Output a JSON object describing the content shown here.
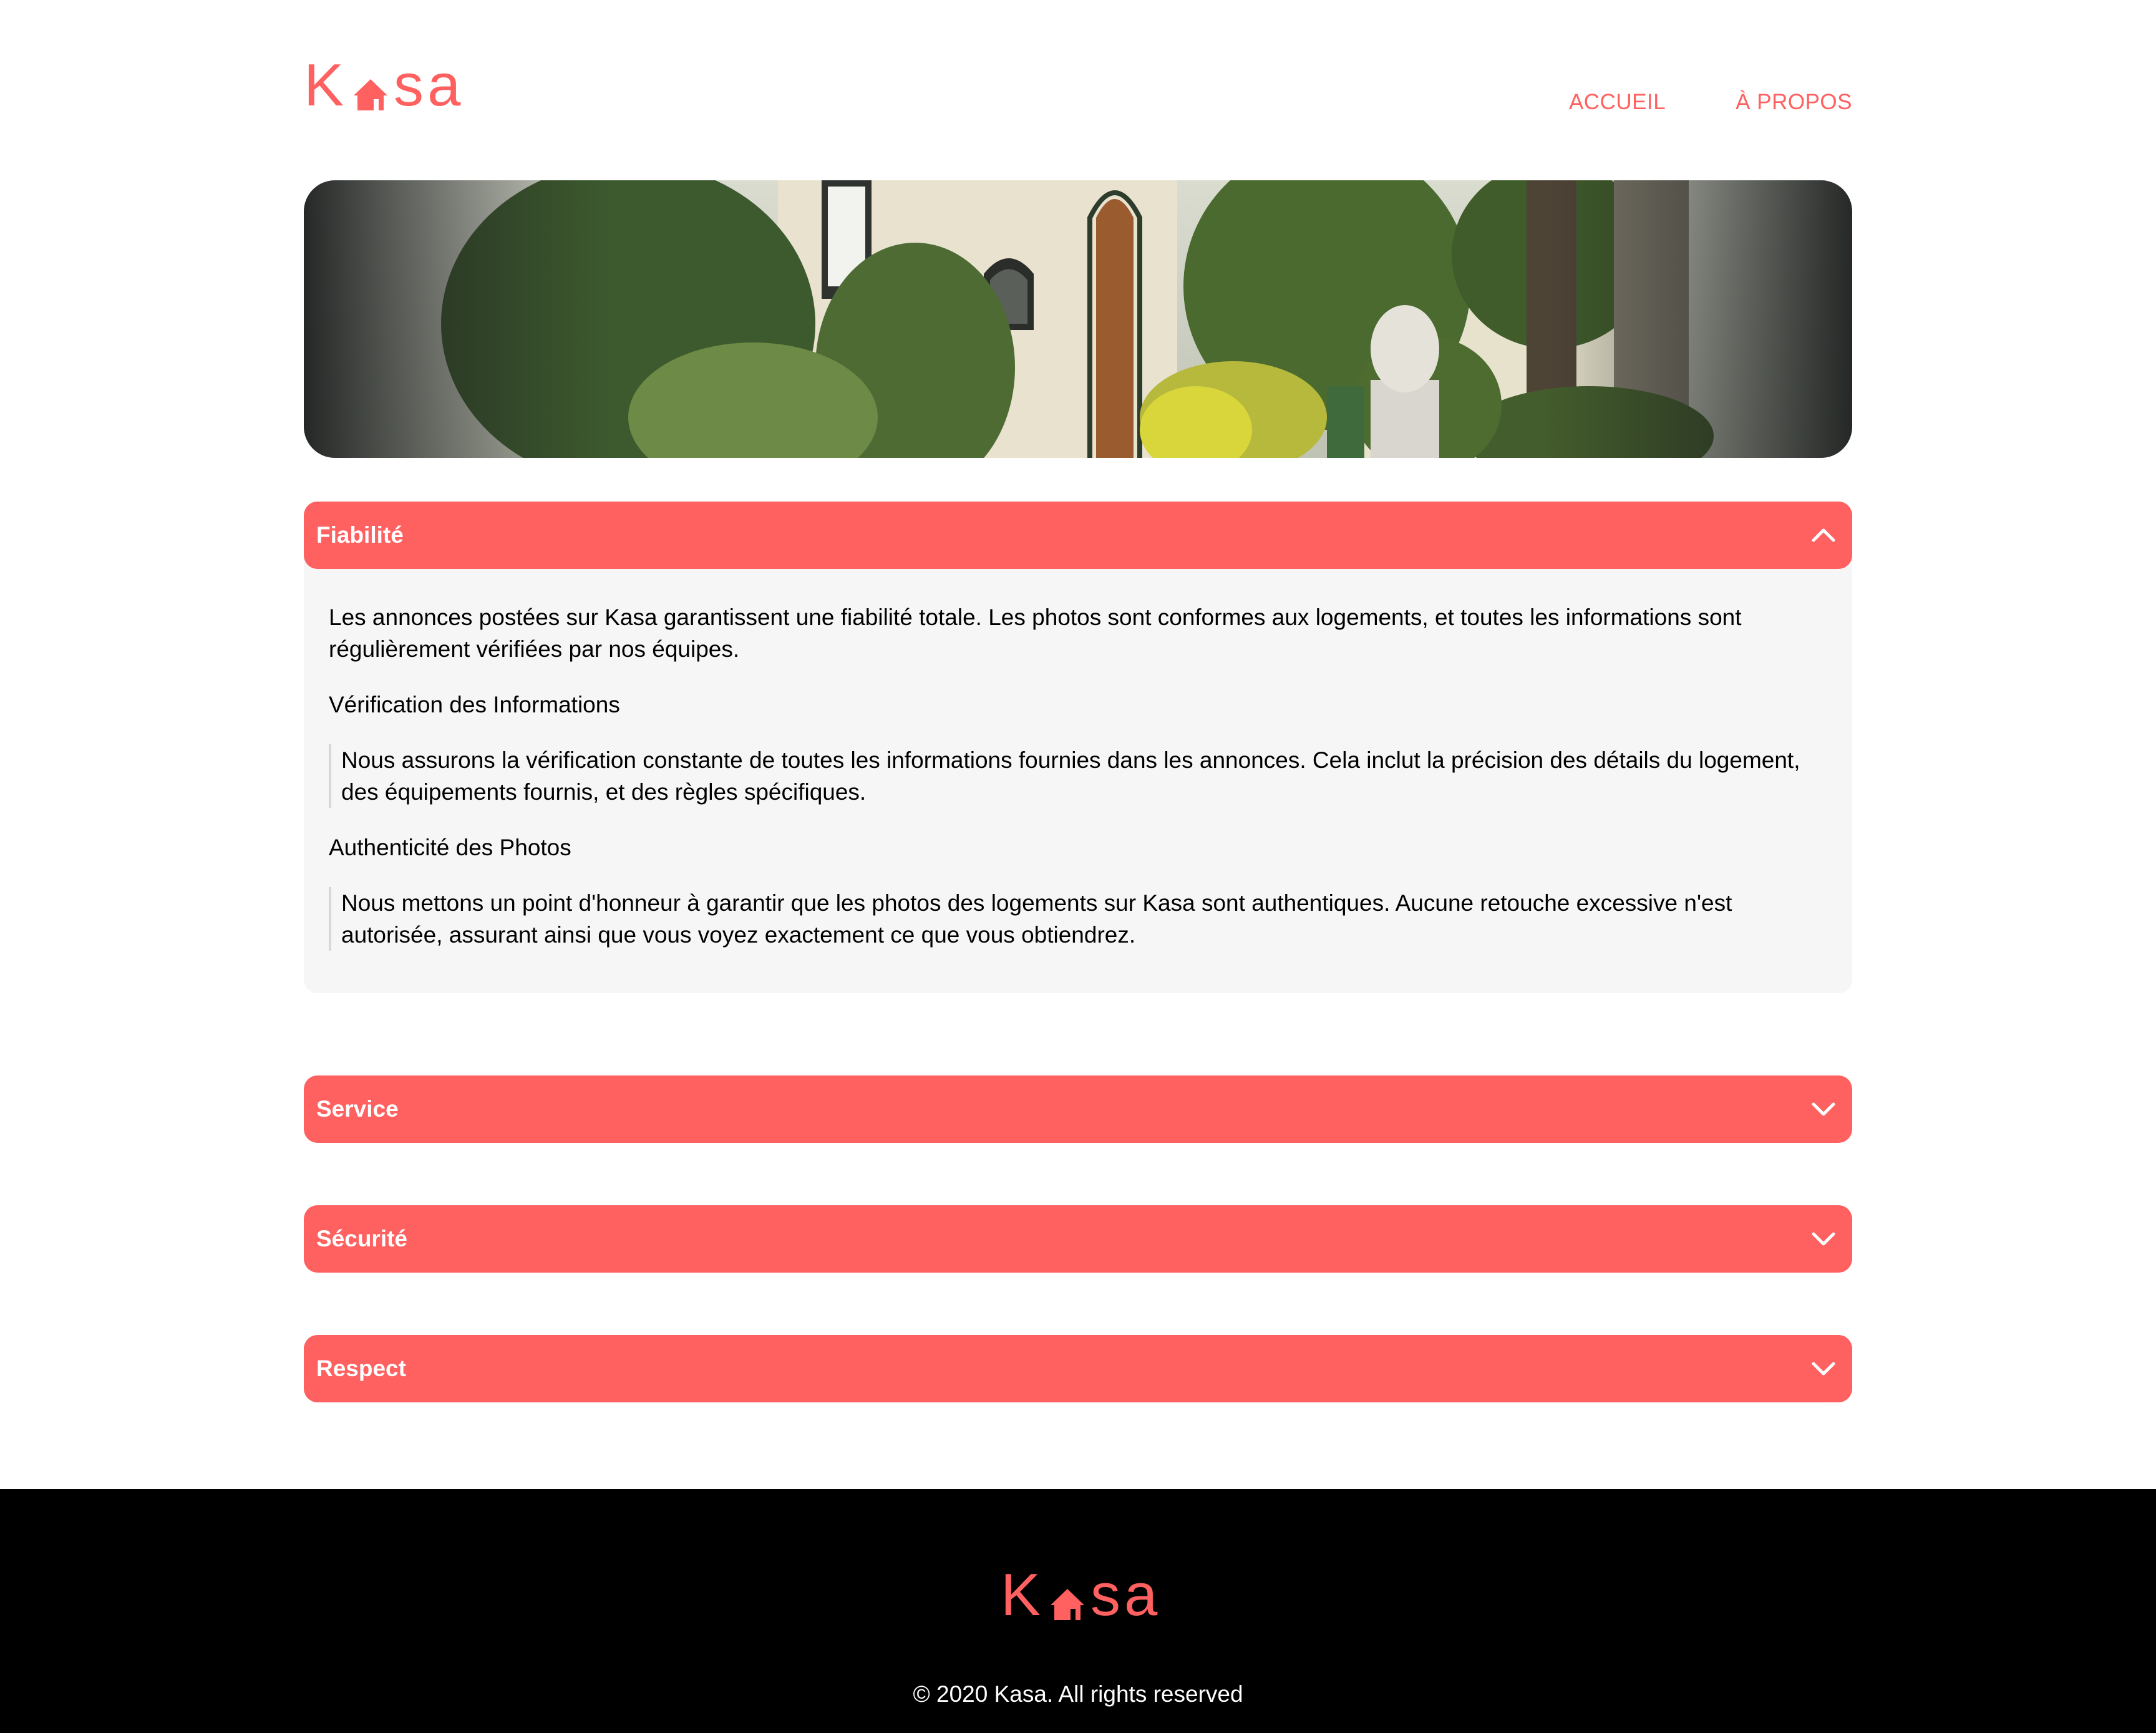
{
  "brand": {
    "logo_left": "K",
    "logo_right": "sa",
    "color": "#FF6060"
  },
  "nav": [
    {
      "label": "ACCUEIL"
    },
    {
      "label": "À PROPOS"
    }
  ],
  "banner": {
    "icon": "house-garden-photo"
  },
  "accordions": [
    {
      "title": "Fiabilité",
      "expanded": true,
      "icon": "chevron-up-icon",
      "lead": "Les annonces postées sur Kasa garantissent une fiabilité totale. Les photos sont conformes aux logements, et toutes les informations sont régulièrement vérifiées par nos équipes.",
      "sections": [
        {
          "heading": "Vérification des Informations",
          "text": "Nous assurons la vérification constante de toutes les informations fournies dans les annonces. Cela inclut la précision des détails du logement, des équipements fournis, et des règles spécifiques."
        },
        {
          "heading": "Authenticité des Photos",
          "text": "Nous mettons un point d'honneur à garantir que les photos des logements sur Kasa sont authentiques. Aucune retouche excessive n'est autorisée, assurant ainsi que vous voyez exactement ce que vous obtiendrez."
        }
      ]
    },
    {
      "title": "Service",
      "expanded": false,
      "icon": "chevron-down-icon"
    },
    {
      "title": "Sécurité",
      "expanded": false,
      "icon": "chevron-down-icon"
    },
    {
      "title": "Respect",
      "expanded": false,
      "icon": "chevron-down-icon"
    }
  ],
  "footer": {
    "copyright": "© 2020 Kasa. All rights reserved"
  }
}
